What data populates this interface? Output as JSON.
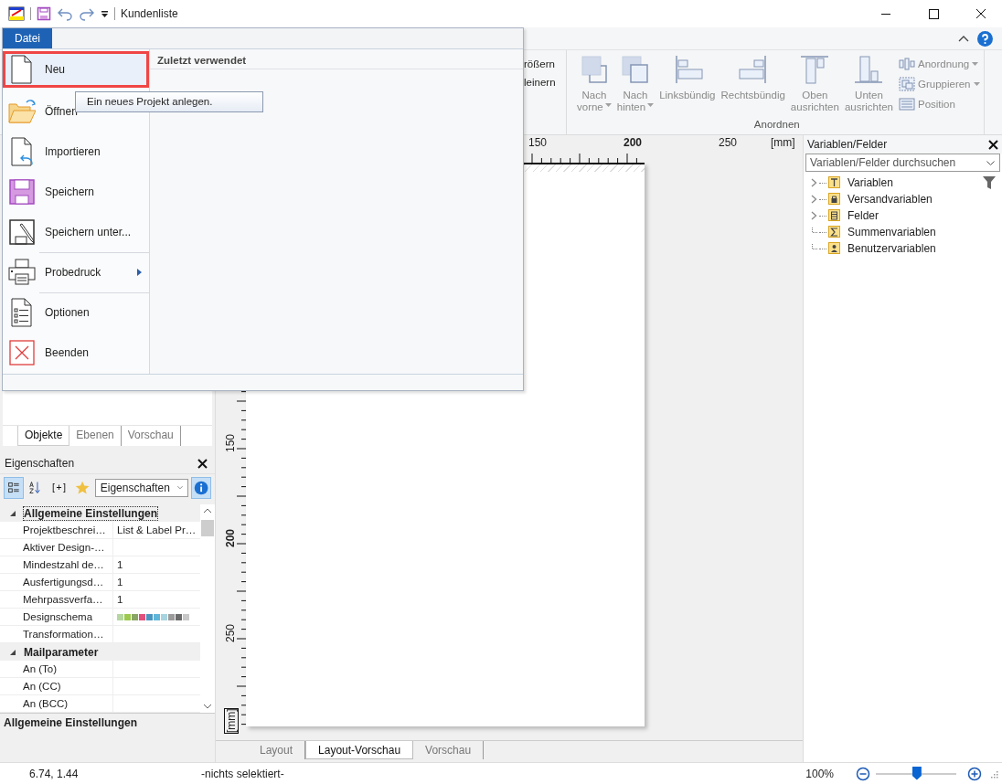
{
  "window": {
    "title": "Kundenliste"
  },
  "ribbon": {
    "partial_labels": [
      "rößern",
      "leinern"
    ],
    "group": {
      "label": "Anordnen",
      "large_buttons": [
        {
          "kind": "front",
          "lines": [
            "Nach",
            "vorne"
          ],
          "dropdown": true
        },
        {
          "kind": "back",
          "lines": [
            "Nach",
            "hinten"
          ],
          "dropdown": true
        },
        {
          "kind": "left",
          "lines": [
            "Linksbündig"
          ],
          "dropdown": false
        },
        {
          "kind": "right",
          "lines": [
            "Rechtsbündig"
          ],
          "dropdown": false
        },
        {
          "kind": "top",
          "lines": [
            "Oben",
            "ausrichten"
          ],
          "dropdown": false
        },
        {
          "kind": "bottom",
          "lines": [
            "Unten",
            "ausrichten"
          ],
          "dropdown": false
        }
      ],
      "small_buttons": [
        {
          "kind": "arrange",
          "label": "Anordnung",
          "dropdown": true
        },
        {
          "kind": "group",
          "label": "Gruppieren",
          "dropdown": true
        },
        {
          "kind": "position",
          "label": "Position",
          "dropdown": false
        }
      ]
    }
  },
  "file_menu": {
    "tab": "Datei",
    "recent_heading": "Zuletzt verwendet",
    "tooltip": "Ein neues Projekt anlegen.",
    "items": [
      {
        "kind": "new",
        "label": "Neu",
        "selected": true,
        "submenu": false,
        "separator_before": false
      },
      {
        "kind": "open",
        "label": "Öffnen",
        "selected": false,
        "submenu": false,
        "separator_before": false
      },
      {
        "kind": "import",
        "label": "Importieren",
        "selected": false,
        "submenu": false,
        "separator_before": false
      },
      {
        "kind": "save",
        "label": "Speichern",
        "selected": false,
        "submenu": false,
        "separator_before": false
      },
      {
        "kind": "saveas",
        "label": "Speichern unter...",
        "selected": false,
        "submenu": false,
        "separator_before": false
      },
      {
        "kind": "print",
        "label": "Probedruck",
        "selected": false,
        "submenu": true,
        "separator_before": true
      },
      {
        "kind": "options",
        "label": "Optionen",
        "selected": false,
        "submenu": false,
        "separator_before": true
      },
      {
        "kind": "exit",
        "label": "Beenden",
        "selected": false,
        "submenu": false,
        "separator_before": false
      }
    ]
  },
  "left_panel": {
    "tabs": [
      {
        "label": "Objekte",
        "selected": true
      },
      {
        "label": "Ebenen",
        "selected": false
      },
      {
        "label": "Vorschau",
        "selected": false
      }
    ],
    "properties": {
      "title": "Eigenschaften",
      "toolbar": [
        {
          "kind": "categorized",
          "pressed": true
        },
        {
          "kind": "sort",
          "pressed": false
        },
        {
          "kind": "expand",
          "label": "[+]",
          "pressed": false
        },
        {
          "kind": "favorite",
          "pressed": false
        }
      ],
      "dropdown": "Eigenschaften",
      "info_pressed": true,
      "groups": [
        {
          "label": "Allgemeine Einstellungen",
          "expanded": true,
          "focused": true,
          "rows": [
            {
              "name": "Projektbeschrei…",
              "value": "List & Label Pr…"
            },
            {
              "name": "Aktiver Design-…"
            },
            {
              "name": "Mindestzahl de…",
              "value": "1"
            },
            {
              "name": "Ausfertigungsd…",
              "value": "1"
            },
            {
              "name": "Mehrpassverfa…",
              "value": "1"
            },
            {
              "name": "Designschema",
              "swatches": [
                {
                  "color": "#b5d6a0"
                },
                {
                  "color": "#9cc94e"
                },
                {
                  "color": "#8aa666"
                },
                {
                  "color": "#e0507a"
                },
                {
                  "color": "#4b94c0"
                },
                {
                  "color": "#5fb6d8"
                },
                {
                  "color": "#a8d4e0"
                },
                {
                  "color": "#9b9b9b"
                },
                {
                  "color": "#6b6b6b"
                },
                {
                  "color": "#c8c8c8"
                }
              ]
            },
            {
              "name": "Transformation…"
            }
          ]
        },
        {
          "label": "Mailparameter",
          "expanded": true,
          "focused": false,
          "rows": [
            {
              "name": "An (To)"
            },
            {
              "name": "An (CC)"
            },
            {
              "name": "An (BCC)"
            }
          ]
        }
      ],
      "description": "Allgemeine Einstellungen"
    }
  },
  "ruler": {
    "top": [
      {
        "label": "150",
        "major": false
      },
      {
        "label": "200",
        "major": true
      },
      {
        "label": "250",
        "major": false
      }
    ],
    "top_unit": "[mm]",
    "left": [
      {
        "label": "150",
        "major": false
      },
      {
        "label": "200",
        "major": true
      },
      {
        "label": "250",
        "major": false
      }
    ],
    "left_unit": "[mm]"
  },
  "view_tabs": [
    {
      "label": "Layout",
      "selected": false
    },
    {
      "label": "Layout-Vorschau",
      "selected": true
    },
    {
      "label": "Vorschau",
      "selected": false
    }
  ],
  "variables_panel": {
    "title": "Variablen/Felder",
    "search_placeholder": "Variablen/Felder durchsuchen",
    "tree": [
      {
        "kind": "text",
        "label": "Variablen",
        "expandable": true
      },
      {
        "kind": "mail",
        "label": "Versandvariablen",
        "expandable": true
      },
      {
        "kind": "table",
        "label": "Felder",
        "expandable": true
      },
      {
        "kind": "sum",
        "label": "Summenvariablen",
        "expandable": false
      },
      {
        "kind": "user",
        "label": "Benutzervariablen",
        "expandable": false
      }
    ]
  },
  "status_bar": {
    "position": "6.74, 1.44",
    "selection": "-nichts selektiert-",
    "zoom": "100%",
    "level": 0.51
  }
}
